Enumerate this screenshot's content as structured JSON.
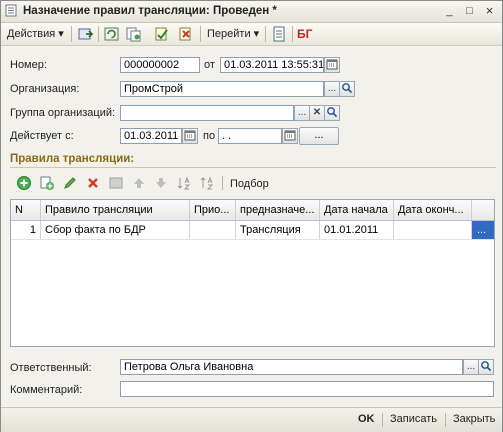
{
  "window": {
    "title": "Назначение правил трансляции: Проведен *",
    "btn_minimize": "_",
    "btn_maximize": "□",
    "btn_close": "×"
  },
  "toolbar": {
    "actions_label": "Действия",
    "goto_label": "Перейти",
    "dropdown_arrow": "▾",
    "bg_label": "БГ"
  },
  "form": {
    "number_label": "Номер:",
    "number_value": "000000002",
    "from_label": "от",
    "date_value": "01.03.2011 13:55:31",
    "org_label": "Организация:",
    "org_value": "ПромСтрой",
    "group_label": "Группа организаций:",
    "group_value": "",
    "valid_from_label": "Действует с:",
    "valid_from_value": "01.03.2011",
    "to_label": "по",
    "valid_to_value": " . .",
    "ellipsis": "...",
    "clear_glyph": "✕",
    "search_glyph": "🔍︎"
  },
  "rules": {
    "section_title": "Правила трансляции:",
    "selection_label": "Подбор",
    "columns": [
      "N",
      "Правило трансляции",
      "Прио...",
      "предназначе...",
      "Дата начала",
      "Дата оконч..."
    ],
    "rows": [
      {
        "n": "1",
        "rule": "Сбор факта по БДР",
        "priority": "",
        "purpose": "Трансляция",
        "start": "01.01.2011",
        "end": "",
        "more": "..."
      }
    ]
  },
  "footer": {
    "responsible_label": "Ответственный:",
    "responsible_value": "Петрова Ольга Ивановна",
    "comment_label": "Комментарий:",
    "comment_value": ""
  },
  "status": {
    "ok_label": "OK",
    "save_label": "Записать",
    "close_label": "Закрыть"
  },
  "colors": {
    "section_title": "#8a6a1a",
    "selected_cell": "#316ac5"
  }
}
